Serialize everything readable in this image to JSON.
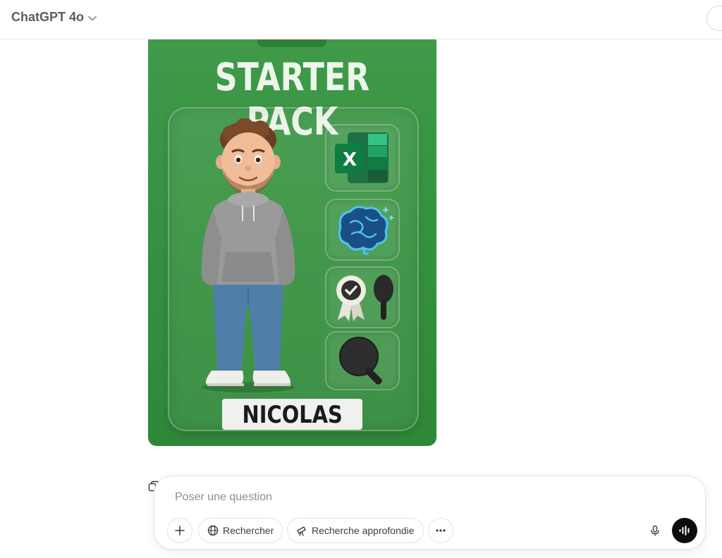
{
  "header": {
    "model_name": "ChatGPT 4o"
  },
  "image": {
    "title": "STARTER PACK",
    "name": "NICOLAS",
    "accessories": [
      "excel-icon",
      "brain-icon",
      "award-ribbon-icon",
      "paddle-icon",
      "ping-pong-paddle-icon"
    ],
    "colors": {
      "card_green": "#3f9a49"
    }
  },
  "composer": {
    "placeholder": "Poser une question",
    "value": "",
    "search_label": "Rechercher",
    "deep_research_label": "Recherche approfondie"
  }
}
